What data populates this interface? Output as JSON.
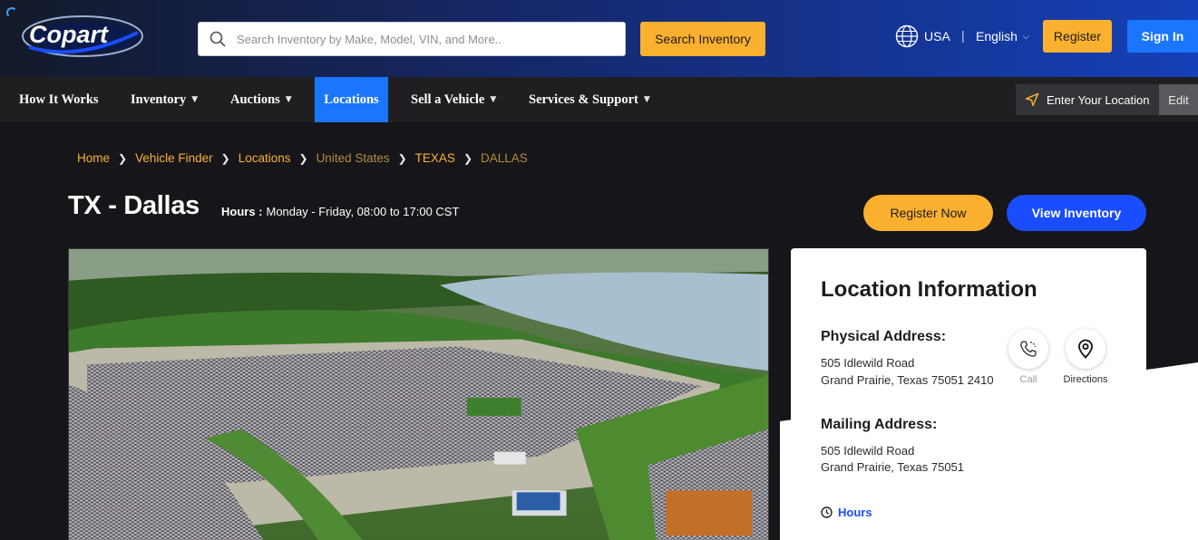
{
  "header": {
    "logo_text": "Copart",
    "search_placeholder": "Search Inventory by Make, Model, VIN, and More..",
    "search_button": "Search Inventory",
    "country": "USA",
    "divider": "|",
    "language": "English",
    "register": "Register",
    "sign_in": "Sign In"
  },
  "nav": {
    "items": [
      {
        "label": "How It Works"
      },
      {
        "label": "Inventory"
      },
      {
        "label": "Auctions"
      },
      {
        "label": "Locations"
      },
      {
        "label": "Sell a Vehicle"
      },
      {
        "label": "Services & Support"
      }
    ],
    "location_prompt": "Enter Your Location",
    "edit": "Edit"
  },
  "breadcrumb": [
    "Home",
    "Vehicle Finder",
    "Locations",
    "United States",
    "TEXAS",
    "DALLAS"
  ],
  "page": {
    "title": "TX - Dallas",
    "hours_label": "Hours :",
    "hours_value": "Monday - Friday, 08:00 to 17:00 CST",
    "register_now": "Register Now",
    "view_inventory": "View Inventory"
  },
  "location_info": {
    "title": "Location Information",
    "physical_heading": "Physical Address:",
    "physical_line1": "505 Idlewild Road",
    "physical_line2": "Grand Prairie, Texas 75051 2410",
    "call_label": "Call",
    "directions_label": "Directions",
    "mailing_heading": "Mailing Address:",
    "mailing_line1": "505 Idlewild Road",
    "mailing_line2": "Grand Prairie, Texas 75051",
    "hours_link": "Hours"
  },
  "colors": {
    "brand_yellow": "#fbb030",
    "brand_blue": "#1a75ff",
    "nav_bg": "#1f1f21",
    "page_bg": "#16161a"
  }
}
